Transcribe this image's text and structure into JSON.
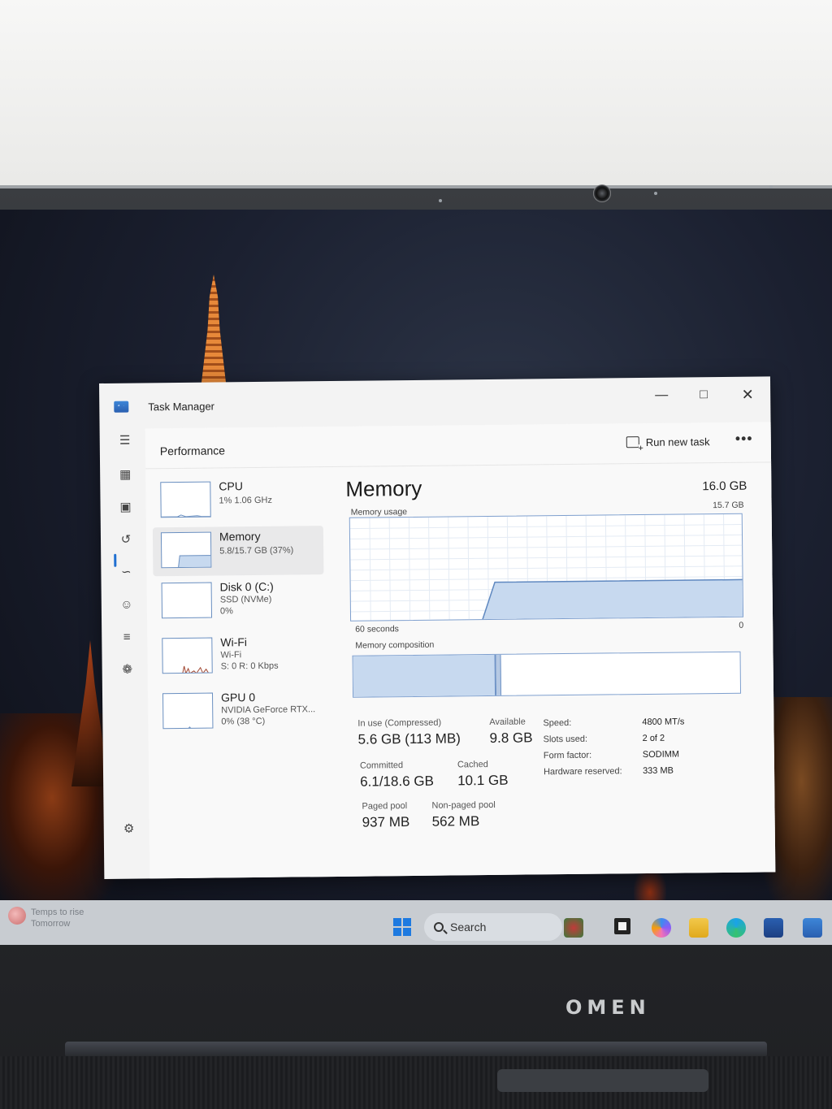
{
  "window": {
    "title": "Task Manager"
  },
  "nav": {
    "items": [
      "menu-icon",
      "processes-icon",
      "performance-icon",
      "app-history-icon",
      "startup-icon",
      "users-icon",
      "details-icon",
      "services-icon",
      "settings-icon"
    ]
  },
  "header": {
    "title": "Performance",
    "run_new_task": "Run new task",
    "more": "•••"
  },
  "resources": [
    {
      "name": "CPU",
      "line1": "1% 1.06 GHz",
      "line2": ""
    },
    {
      "name": "Memory",
      "line1": "5.8/15.7 GB (37%)",
      "line2": ""
    },
    {
      "name": "Disk 0 (C:)",
      "line1": "SSD (NVMe)",
      "line2": "0%"
    },
    {
      "name": "Wi-Fi",
      "line1": "Wi-Fi",
      "line2": "S: 0 R: 0 Kbps"
    },
    {
      "name": "GPU 0",
      "line1": "NVIDIA GeForce RTX...",
      "line2": "0% (38 °C)"
    }
  ],
  "memory": {
    "title": "Memory",
    "total": "16.0 GB",
    "usage_label": "Memory usage",
    "usage_max": "15.7 GB",
    "axis_left": "60 seconds",
    "axis_right": "0",
    "composition_label": "Memory composition",
    "stats": {
      "in_use_label": "In use (Compressed)",
      "in_use": "5.6 GB (113 MB)",
      "available_label": "Available",
      "available": "9.8 GB",
      "committed_label": "Committed",
      "committed": "6.1/18.6 GB",
      "cached_label": "Cached",
      "cached": "10.1 GB",
      "paged_label": "Paged pool",
      "paged": "937 MB",
      "nonpaged_label": "Non-paged pool",
      "nonpaged": "562 MB"
    },
    "specs": [
      {
        "label": "Speed:",
        "value": "4800 MT/s"
      },
      {
        "label": "Slots used:",
        "value": "2 of 2"
      },
      {
        "label": "Form factor:",
        "value": "SODIMM"
      },
      {
        "label": "Hardware reserved:",
        "value": "333 MB"
      }
    ]
  },
  "chart_data": {
    "type": "area",
    "ylim": [
      0,
      15.7
    ],
    "xlabel": "60 seconds",
    "x": [
      60,
      40,
      38,
      0
    ],
    "values": [
      null,
      null,
      5.8,
      5.8
    ]
  },
  "taskbar": {
    "weather_line1": "Temps to rise",
    "weather_line2": "Tomorrow",
    "search": "Search"
  },
  "brand": "OMEN",
  "colors": {
    "accent": "#1f6fd1",
    "graph_fill": "#c7d9ef",
    "graph_border": "#7e9fce",
    "taskbar": "#c8ccd1"
  }
}
